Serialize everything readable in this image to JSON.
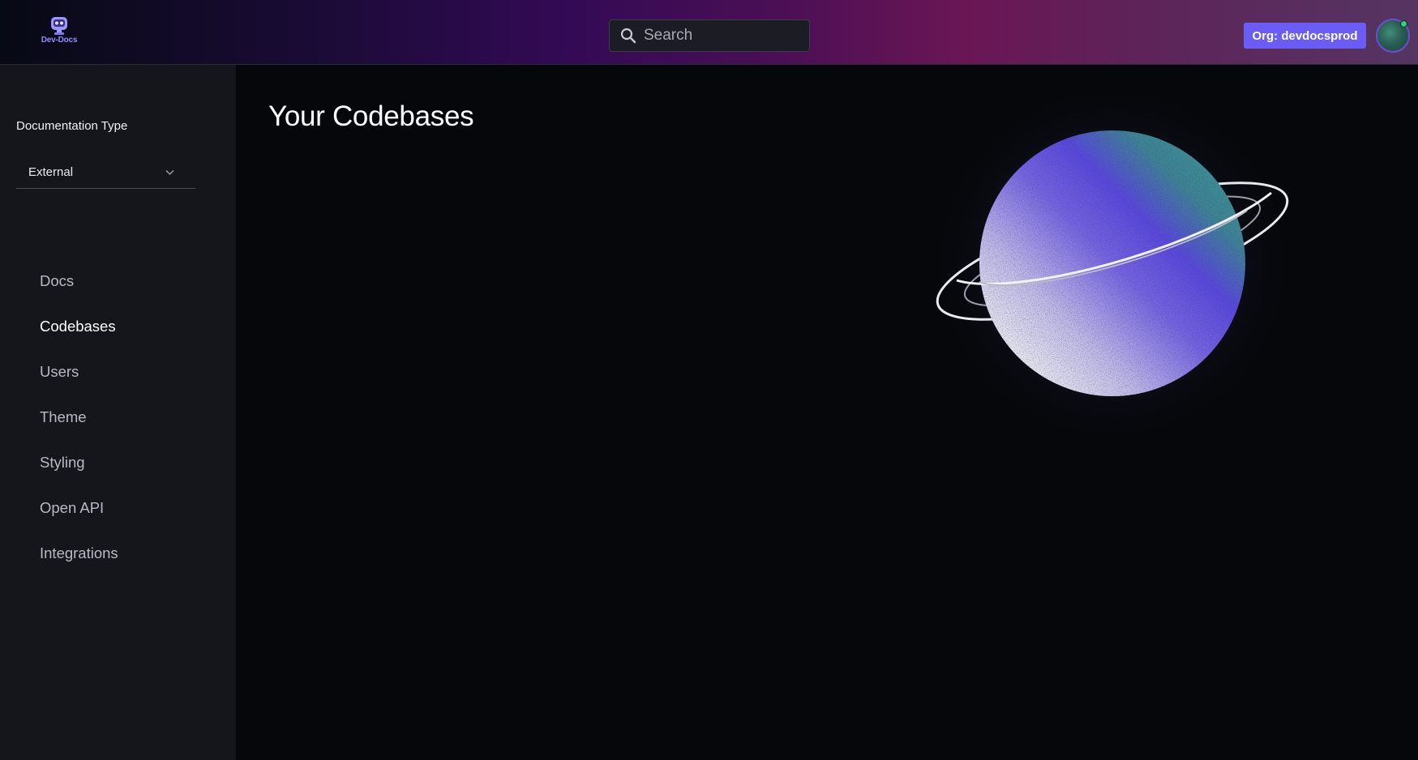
{
  "header": {
    "logo_text": "Dev-Docs",
    "search_placeholder": "Search",
    "org_button_label": "Org: devdocsprod"
  },
  "sidebar": {
    "doc_type_label": "Documentation Type",
    "doc_type_value": "External",
    "items": [
      {
        "label": "Docs",
        "active": false
      },
      {
        "label": "Codebases",
        "active": true
      },
      {
        "label": "Users",
        "active": false
      },
      {
        "label": "Theme",
        "active": false
      },
      {
        "label": "Styling",
        "active": false
      },
      {
        "label": "Open API",
        "active": false
      },
      {
        "label": "Integrations",
        "active": false
      }
    ]
  },
  "main": {
    "title": "Your Codebases"
  },
  "colors": {
    "accent": "#6b5cf6",
    "status_online": "#2bd576",
    "sidebar_bg": "#14161c",
    "main_bg": "#05070b"
  },
  "icons": {
    "logo": "robot-logo-icon",
    "search": "search-icon",
    "select": "chevron-down-icon",
    "illustration": "planet-illustration"
  }
}
